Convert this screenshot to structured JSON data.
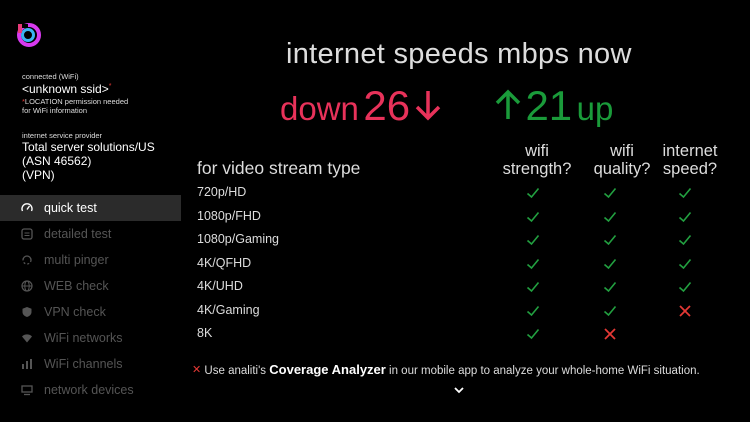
{
  "sidebar": {
    "connection_label": "connected (WiFi)",
    "ssid": "<unknown ssid>",
    "ssid_star": "*",
    "location_note_star": "*",
    "location_note_1": "LOCATION permission needed",
    "location_note_2": "for WiFi information",
    "isp_label": "internet service provider",
    "isp_line_1": "Total server solutions/US",
    "isp_line_2": "(ASN 46562)",
    "isp_line_3": "(VPN)",
    "nav": [
      {
        "label": "quick test",
        "icon": "gauge-icon",
        "active": true
      },
      {
        "label": "detailed test",
        "icon": "detailed-test-icon",
        "active": false
      },
      {
        "label": "multi pinger",
        "icon": "multi-pinger-icon",
        "active": false
      },
      {
        "label": "WEB check",
        "icon": "globe-icon",
        "active": false
      },
      {
        "label": "VPN check",
        "icon": "shield-icon",
        "active": false
      },
      {
        "label": "WiFi networks",
        "icon": "wifi-icon",
        "active": false
      },
      {
        "label": "WiFi channels",
        "icon": "channels-icon",
        "active": false
      },
      {
        "label": "network devices",
        "icon": "devices-icon",
        "active": false
      }
    ]
  },
  "main": {
    "title": "internet speeds mbps now",
    "down_label": "down",
    "down_value": "26",
    "up_value": "21",
    "up_label": "up",
    "down_color": "#e8325a",
    "up_color": "#1a9b3a",
    "table_title": "for video stream type",
    "columns": [
      {
        "line1": "wifi",
        "line2": "strength?"
      },
      {
        "line1": "wifi",
        "line2": "quality?"
      },
      {
        "line1": "internet",
        "line2": "speed?"
      }
    ],
    "rows": [
      {
        "label": "720p/HD",
        "cells": [
          "check",
          "check",
          "check"
        ]
      },
      {
        "label": "1080p/FHD",
        "cells": [
          "check",
          "check",
          "check"
        ]
      },
      {
        "label": "1080p/Gaming",
        "cells": [
          "check",
          "check",
          "check"
        ]
      },
      {
        "label": "4K/QFHD",
        "cells": [
          "check",
          "check",
          "check"
        ]
      },
      {
        "label": "4K/UHD",
        "cells": [
          "check",
          "check",
          "check"
        ]
      },
      {
        "label": "4K/Gaming",
        "cells": [
          "check",
          "check",
          "cross"
        ]
      },
      {
        "label": "8K",
        "cells": [
          "check",
          "cross",
          ""
        ]
      }
    ],
    "note_prefix": "Use analiti's ",
    "note_bold": "Coverage Analyzer",
    "note_suffix": " in our mobile app to analyze your whole-home WiFi situation.",
    "check_color": "#22a040",
    "cross_color": "#e53935"
  }
}
